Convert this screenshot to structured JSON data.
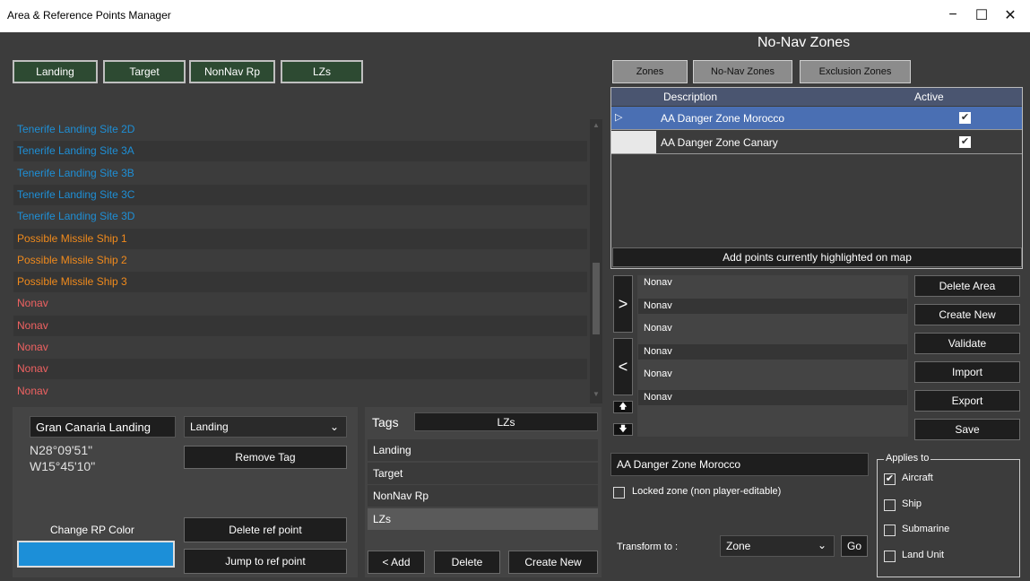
{
  "window": {
    "title": "Area & Reference Points Manager",
    "minimize": "−",
    "maximize": "☐",
    "close": "✕"
  },
  "filter_buttons": [
    "Landing",
    "Target",
    "NonNav Rp",
    "LZs"
  ],
  "ref_points": [
    {
      "label": "Tenerife Landing Site 2D",
      "color": "#1e8fd6"
    },
    {
      "label": "Tenerife Landing Site 3A",
      "color": "#1e8fd6"
    },
    {
      "label": "Tenerife Landing Site 3B",
      "color": "#1e8fd6"
    },
    {
      "label": "Tenerife Landing Site 3C",
      "color": "#1e8fd6"
    },
    {
      "label": "Tenerife Landing Site 3D",
      "color": "#1e8fd6"
    },
    {
      "label": "Possible Missile Ship 1",
      "color": "#f08a1c"
    },
    {
      "label": "Possible Missile Ship 2",
      "color": "#f08a1c"
    },
    {
      "label": "Possible Missile Ship 3",
      "color": "#f08a1c"
    },
    {
      "label": "Nonav",
      "color": "#f06262"
    },
    {
      "label": "Nonav",
      "color": "#f06262"
    },
    {
      "label": "Nonav",
      "color": "#f06262"
    },
    {
      "label": "Nonav",
      "color": "#f06262"
    },
    {
      "label": "Nonav",
      "color": "#f06262"
    }
  ],
  "point_detail": {
    "name": "Gran Canaria Landing",
    "tag_select": "Landing",
    "lat": "N28°09'51\"",
    "lon": "W15°45'10\"",
    "remove_tag": "Remove Tag",
    "change_color_label": "Change RP Color",
    "color": "#1c8fd8",
    "delete_ref_point": "Delete ref point",
    "jump_to_ref_point": "Jump to ref point"
  },
  "tags": {
    "header": "Tags",
    "current": "LZs",
    "items": [
      "Landing",
      "Target",
      "NonNav Rp",
      "LZs"
    ],
    "add": "< Add",
    "delete": "Delete",
    "create_new": "Create New"
  },
  "zones": {
    "title": "No-Nav Zones",
    "tabs": [
      "Zones",
      "No-Nav Zones",
      "Exclusion Zones"
    ],
    "columns": [
      "Description",
      "Active"
    ],
    "rows": [
      {
        "description": "AA Danger Zone Morocco",
        "active": true,
        "selected": true
      },
      {
        "description": "AA Danger Zone Canary",
        "active": true,
        "selected": false
      }
    ],
    "add_points": "Add points currently highlighted on map",
    "points": [
      "Nonav",
      "Nonav",
      "Nonav",
      "Nonav",
      "Nonav",
      "Nonav"
    ],
    "move_right": ">",
    "move_left": "<",
    "move_up": "🡅",
    "move_down": "🡇",
    "actions": [
      "Delete Area",
      "Create New",
      "Validate",
      "Import",
      "Export",
      "Save"
    ],
    "name_value": "AA Danger Zone Morocco",
    "locked_label": "Locked zone (non player-editable)",
    "transform_label": "Transform to :",
    "transform_value": "Zone",
    "go": "Go",
    "applies_to_title": "Applies to",
    "applies_to": [
      {
        "label": "Aircraft",
        "checked": true
      },
      {
        "label": "Ship",
        "checked": false
      },
      {
        "label": "Submarine",
        "checked": false
      },
      {
        "label": "Land Unit",
        "checked": false
      }
    ]
  }
}
